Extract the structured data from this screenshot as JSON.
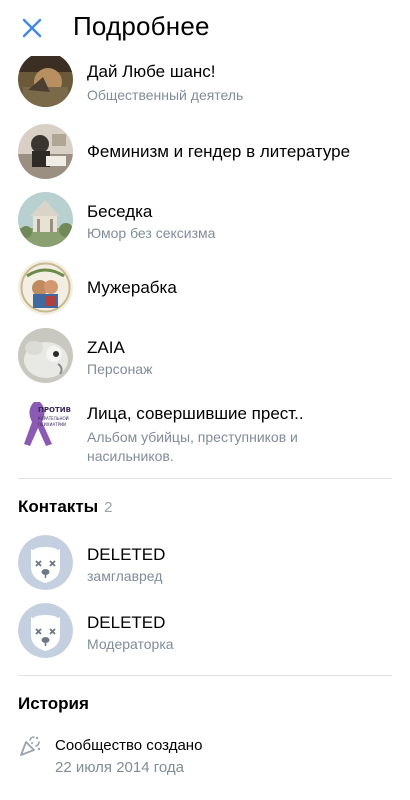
{
  "header": {
    "title": "Подробнее"
  },
  "links": [
    {
      "title": "Дай Любе шанс!",
      "subtitle": "Общественный деятель"
    },
    {
      "title": "Феминизм и гендер в литературе",
      "subtitle": ""
    },
    {
      "title": "Беседка",
      "subtitle": "Юмор без сексизма"
    },
    {
      "title": "Мужерабка",
      "subtitle": ""
    },
    {
      "title": "ZAIA",
      "subtitle": "Персонаж"
    },
    {
      "title": "Лица, совершившие прест..",
      "subtitle_line1": "Альбом убийцы, преступников и",
      "subtitle_line2": "насильников.",
      "avatar_text_top": "ПРОТИВ",
      "avatar_text_mid": "КАРАТЕЛЬНОЙ",
      "avatar_text_bot": "ПСИХИАТРИИ"
    }
  ],
  "contacts": {
    "title": "Контакты",
    "count": "2",
    "items": [
      {
        "name": "DELETED",
        "role": "замглавред"
      },
      {
        "name": "DELETED",
        "role": "Модераторка"
      }
    ]
  },
  "history": {
    "title": "История",
    "event": "Сообщество создано",
    "date": "22 июля 2014 года"
  },
  "colors": {
    "accent": "#3f8ae0",
    "secondary_text": "#818c99",
    "divider": "#e1e3e6",
    "deleted_avatar_bg": "#c4d0df",
    "ribbon": "#8b5bb3"
  },
  "icons": {
    "close": "close-icon",
    "history": "party-popper-icon"
  }
}
